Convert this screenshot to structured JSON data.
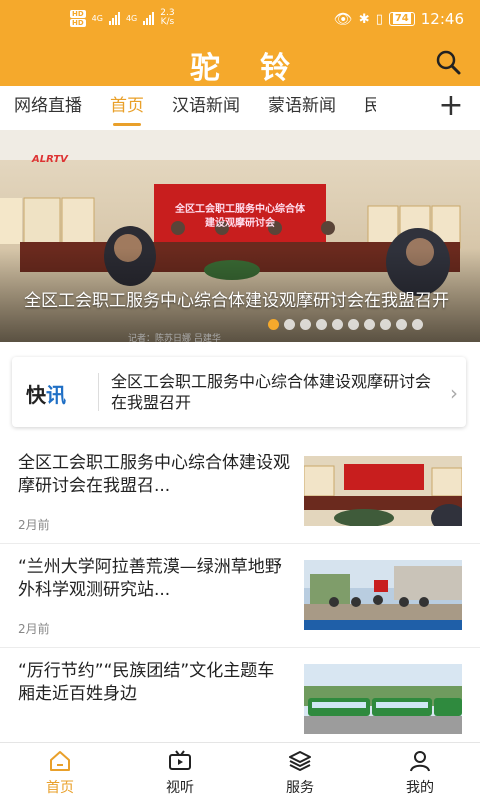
{
  "status_bar": {
    "hd1": "HD",
    "hd2": "HD",
    "net1": "4G",
    "net2": "4G",
    "speed_value": "2.3",
    "speed_unit": "K/s",
    "battery": "74",
    "time": "12:46"
  },
  "header": {
    "title": "驼铃"
  },
  "tabs": [
    {
      "label": "网络直播"
    },
    {
      "label": "首页"
    },
    {
      "label": "汉语新闻"
    },
    {
      "label": "蒙语新闻"
    },
    {
      "label": "民"
    }
  ],
  "active_tab": "首页",
  "banner": {
    "caption": "全区工会职工服务中心综合体建设观摩研讨会在我盟召开",
    "logo_text": "ALRTV",
    "screen_text_1": "全区工会职工服务中心综合体",
    "screen_text_2": "建设观摩研讨会",
    "reporter": "记者：陈苏日娜 吕建华",
    "slide_count": 10,
    "active_slide": 1
  },
  "flash_news": {
    "logo_a": "快",
    "logo_b": "讯",
    "text": "全区工会职工服务中心综合体建设观摩研讨会在我盟召开"
  },
  "news": [
    {
      "title": "全区工会职工服务中心综合体建设观摩研讨会在我盟召...",
      "time": "2月前"
    },
    {
      "title": "“兰州大学阿拉善荒漠—绿洲草地野外科学观测研究站...",
      "time": "2月前"
    },
    {
      "title": "“厉行节约”“民族团结”文化主题车厢走近百姓身边",
      "time": ""
    }
  ],
  "bottom_nav": [
    {
      "label": "首页",
      "icon": "home-icon"
    },
    {
      "label": "视听",
      "icon": "video-icon"
    },
    {
      "label": "服务",
      "icon": "layers-icon"
    },
    {
      "label": "我的",
      "icon": "user-icon"
    }
  ],
  "colors": {
    "brand": "#f5a92c",
    "active_text": "#e9a02a"
  }
}
